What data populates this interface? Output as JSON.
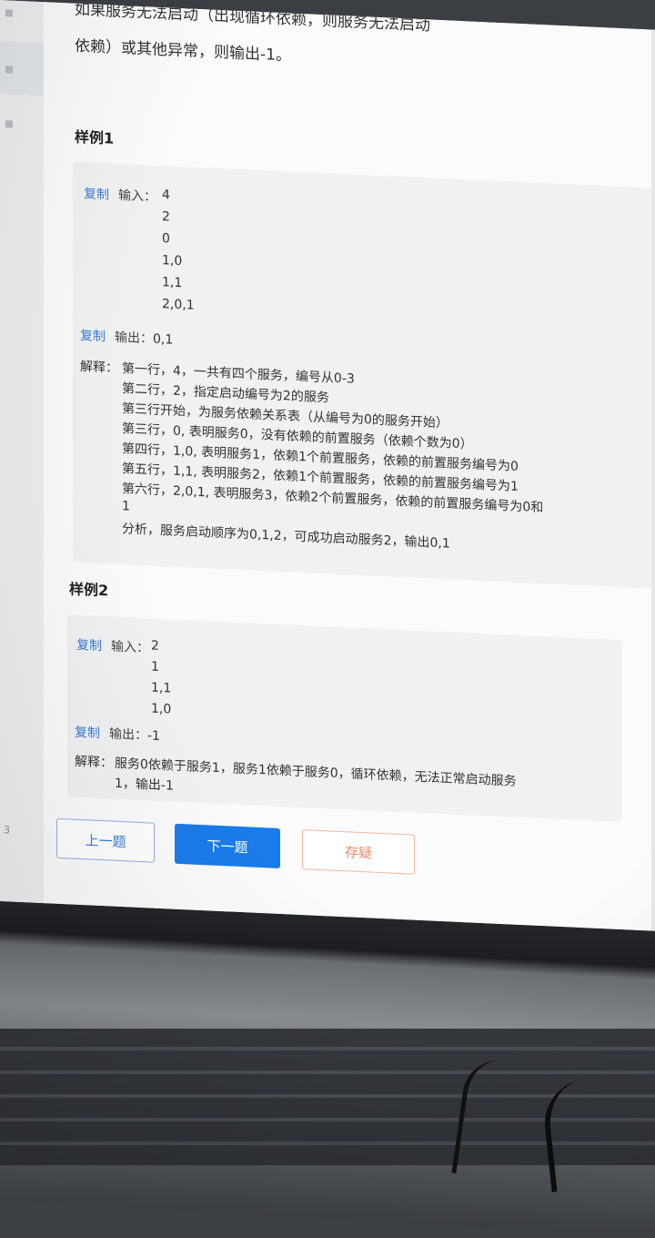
{
  "problem": {
    "text_line1": "如果服务无法启动（出现循环依赖，则服务无法启动",
    "text_line2": "依赖）或其他异常，则输出-1。"
  },
  "sample1": {
    "title": "样例1",
    "copy_label": "复制",
    "input_label": "输入：",
    "input_lines": [
      "4",
      "2",
      "0",
      "1,0",
      "1,1",
      "2,0,1"
    ],
    "output_label": "输出：",
    "output_value": "0,1",
    "explain_label": "解释：",
    "explain_lines": [
      "第一行，4，一共有四个服务，编号从0-3",
      "第二行，2，指定启动编号为2的服务",
      "第三行开始，为服务依赖关系表（从编号为0的服务开始）",
      "第三行，0, 表明服务0，没有依赖的前置服务（依赖个数为0）",
      "第四行，1,0, 表明服务1，依赖1个前置服务，依赖的前置服务编号为0",
      "第五行，1,1, 表明服务2，依赖1个前置服务，依赖的前置服务编号为1",
      "第六行，2,0,1, 表明服务3，依赖2个前置服务，依赖的前置服务编号为0和",
      "1",
      "分析，服务启动顺序为0,1,2，可成功启动服务2，输出0,1"
    ]
  },
  "sample2": {
    "title": "样例2",
    "copy_label": "复制",
    "input_label": "输入：",
    "input_lines": [
      "2",
      "1",
      "1,1",
      "1,0"
    ],
    "output_label": "输出：",
    "output_value": "-1",
    "explain_label": "解释：",
    "explain_lines": [
      "服务0依赖于服务1，服务1依赖于服务0，循环依赖，无法正常启动服务",
      "1，输出-1"
    ]
  },
  "buttons": {
    "prev": "上一题",
    "next": "下一题",
    "doubt": "存疑"
  },
  "sidebar": {
    "page_number": "3"
  },
  "colors": {
    "accent": "#1a7bea",
    "copy_link": "#3a7bd5",
    "doubt": "#f08a66"
  }
}
